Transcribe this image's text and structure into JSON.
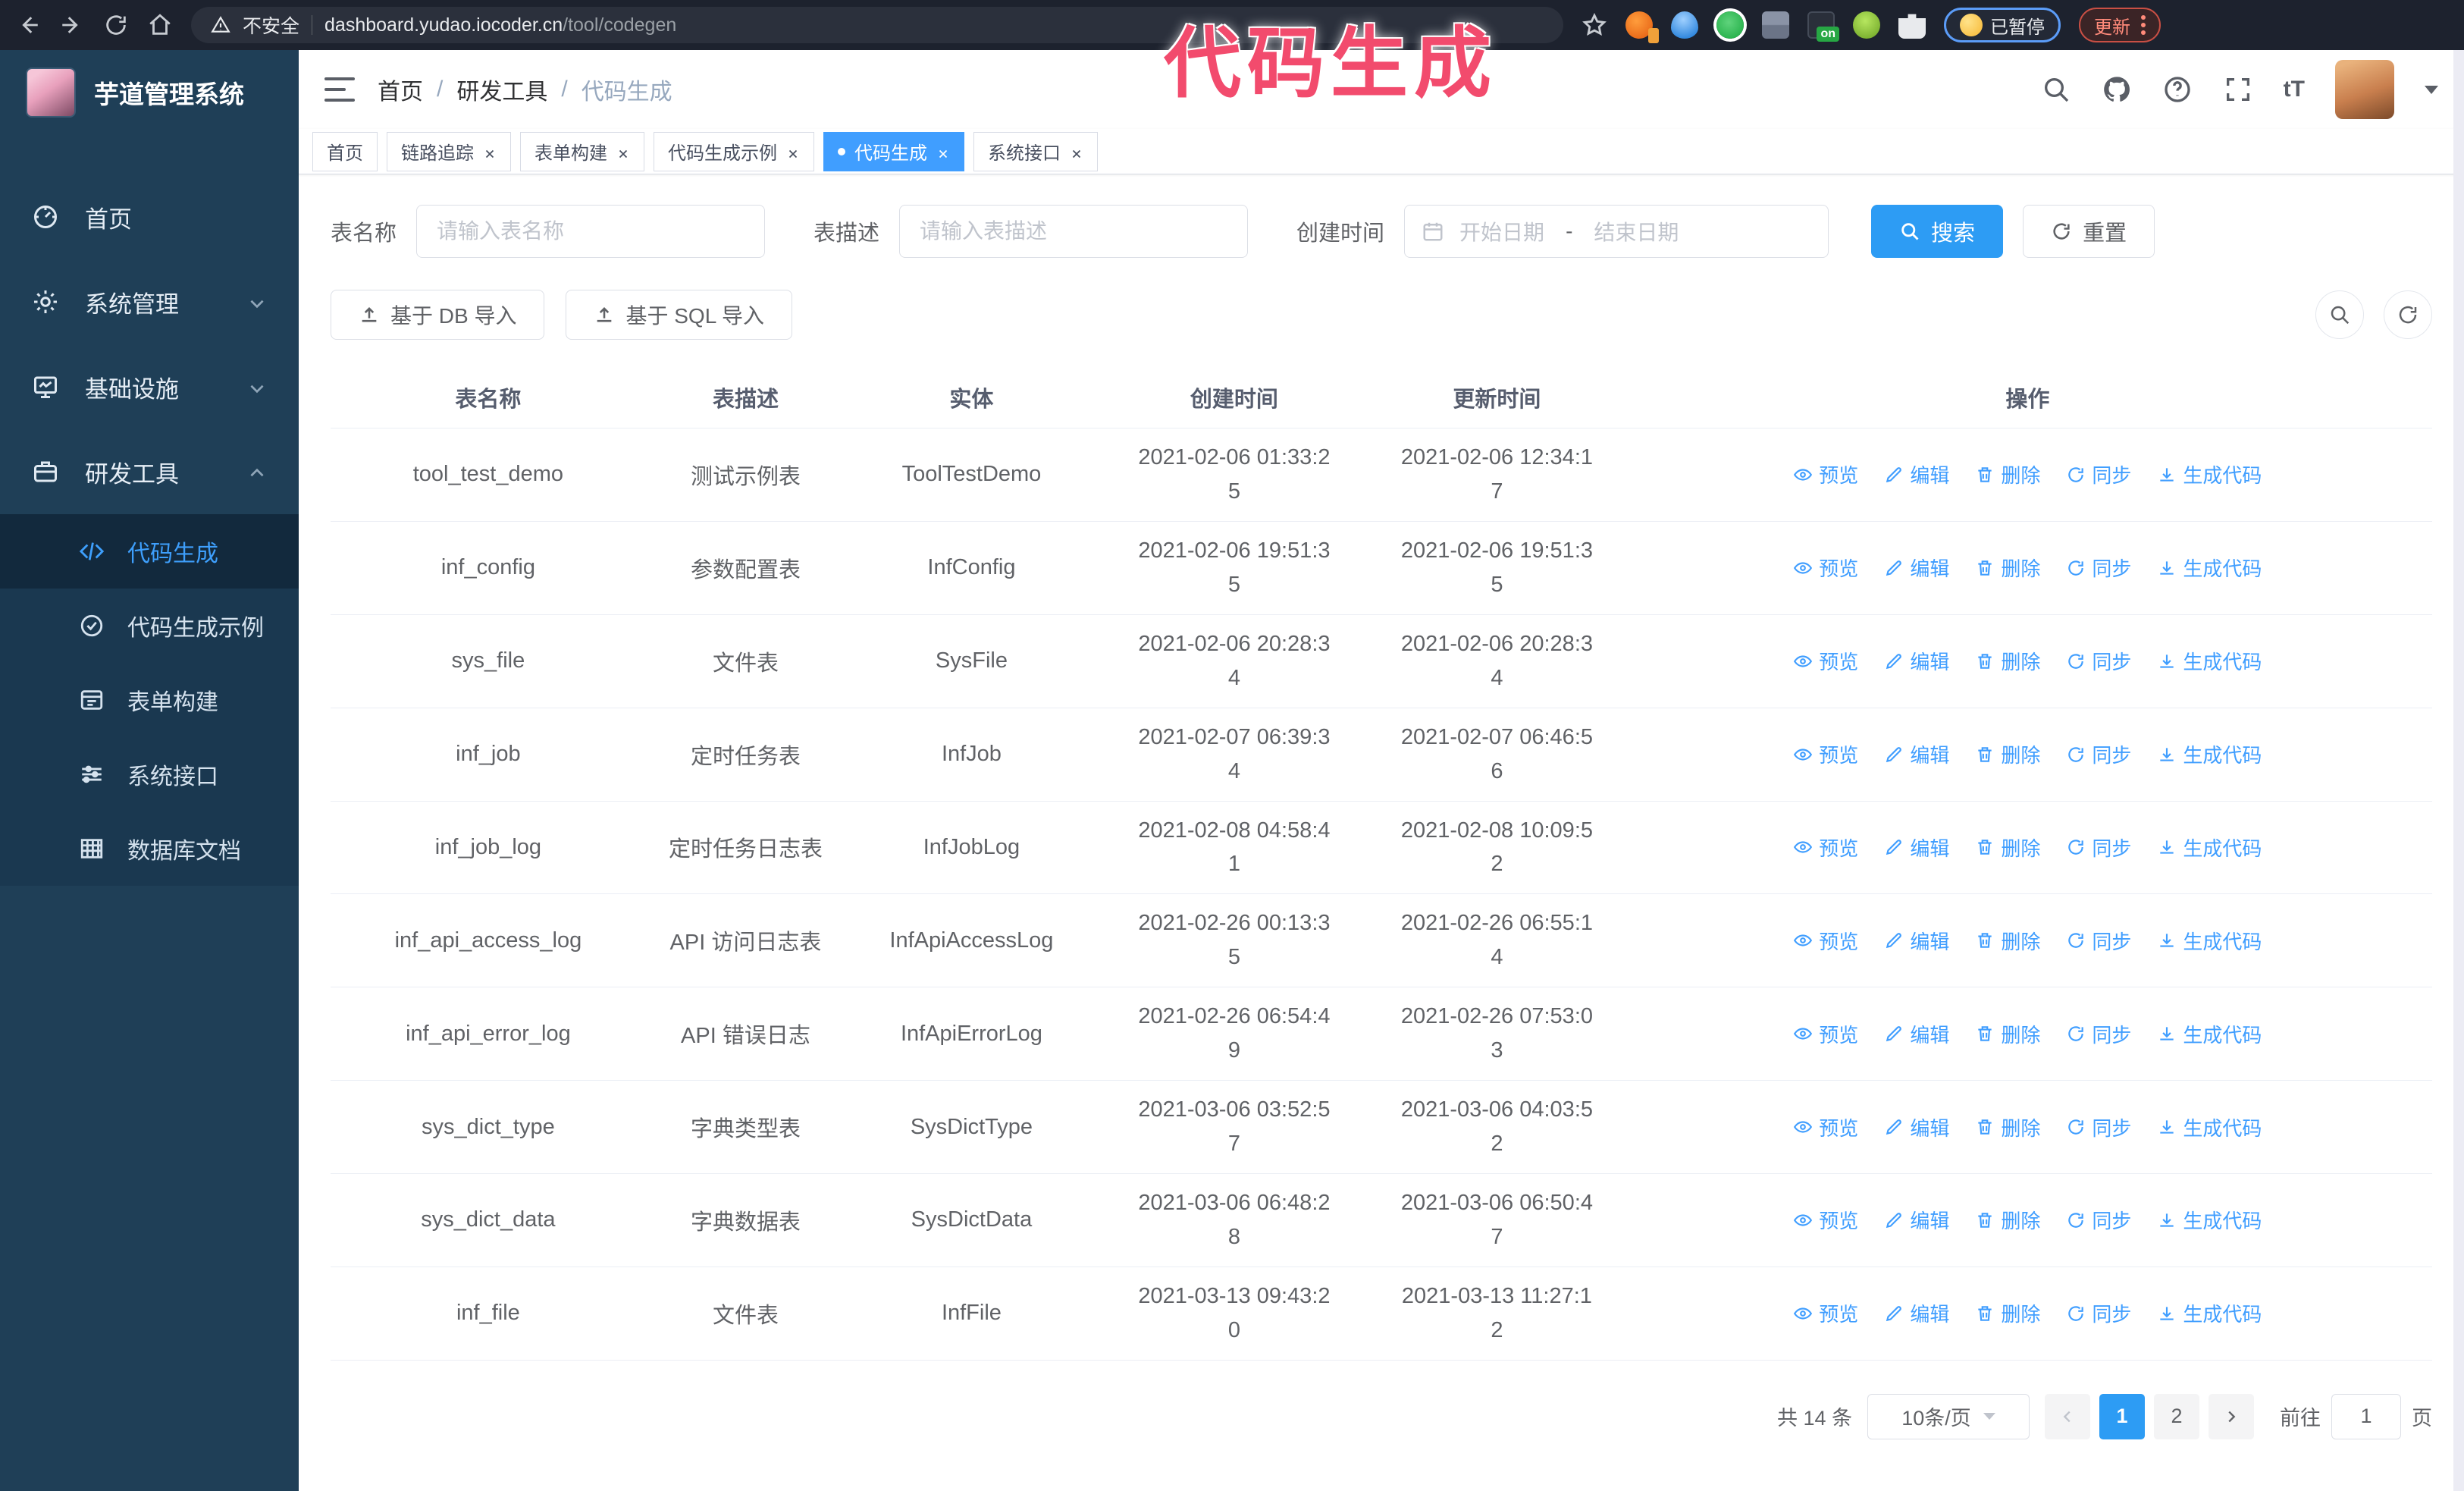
{
  "browser": {
    "security_label": "不安全",
    "url_host": "dashboard.yudao.iocoder.cn",
    "url_path": "/tool/codegen",
    "ext_on_label": "on",
    "paused_label": "已暂停",
    "update_label": "更新"
  },
  "annotation": "代码生成",
  "sidebar": {
    "title": "芋道管理系统",
    "items": [
      {
        "label": "首页"
      },
      {
        "label": "系统管理"
      },
      {
        "label": "基础设施"
      },
      {
        "label": "研发工具"
      }
    ],
    "submenu": [
      {
        "label": "代码生成"
      },
      {
        "label": "代码生成示例"
      },
      {
        "label": "表单构建"
      },
      {
        "label": "系统接口"
      },
      {
        "label": "数据库文档"
      }
    ]
  },
  "breadcrumb": {
    "separator": "/",
    "items": [
      "首页",
      "研发工具",
      "代码生成"
    ]
  },
  "tabs": [
    {
      "label": "首页",
      "closable": false,
      "active": false
    },
    {
      "label": "链路追踪",
      "closable": true,
      "active": false
    },
    {
      "label": "表单构建",
      "closable": true,
      "active": false
    },
    {
      "label": "代码生成示例",
      "closable": true,
      "active": false
    },
    {
      "label": "代码生成",
      "closable": true,
      "active": true
    },
    {
      "label": "系统接口",
      "closable": true,
      "active": false
    }
  ],
  "search_form": {
    "table_name_label": "表名称",
    "table_name_placeholder": "请输入表名称",
    "table_desc_label": "表描述",
    "table_desc_placeholder": "请输入表描述",
    "create_time_label": "创建时间",
    "start_date_placeholder": "开始日期",
    "range_separator": "-",
    "end_date_placeholder": "结束日期",
    "search_label": "搜索",
    "reset_label": "重置"
  },
  "toolbar": {
    "import_db_label": "基于 DB 导入",
    "import_sql_label": "基于 SQL 导入"
  },
  "table": {
    "columns": [
      "表名称",
      "表描述",
      "实体",
      "创建时间",
      "更新时间",
      "操作"
    ],
    "actions": [
      "预览",
      "编辑",
      "删除",
      "同步",
      "生成代码"
    ],
    "rows": [
      {
        "name": "tool_test_demo",
        "desc": "测试示例表",
        "entity": "ToolTestDemo",
        "created": "2021-02-06 01:33:25",
        "updated": "2021-02-06 12:34:17"
      },
      {
        "name": "inf_config",
        "desc": "参数配置表",
        "entity": "InfConfig",
        "created": "2021-02-06 19:51:35",
        "updated": "2021-02-06 19:51:35"
      },
      {
        "name": "sys_file",
        "desc": "文件表",
        "entity": "SysFile",
        "created": "2021-02-06 20:28:34",
        "updated": "2021-02-06 20:28:34"
      },
      {
        "name": "inf_job",
        "desc": "定时任务表",
        "entity": "InfJob",
        "created": "2021-02-07 06:39:34",
        "updated": "2021-02-07 06:46:56"
      },
      {
        "name": "inf_job_log",
        "desc": "定时任务日志表",
        "entity": "InfJobLog",
        "created": "2021-02-08 04:58:41",
        "updated": "2021-02-08 10:09:52"
      },
      {
        "name": "inf_api_access_log",
        "desc": "API 访问日志表",
        "entity": "InfApiAccessLog",
        "created": "2021-02-26 00:13:35",
        "updated": "2021-02-26 06:55:14"
      },
      {
        "name": "inf_api_error_log",
        "desc": "API 错误日志",
        "entity": "InfApiErrorLog",
        "created": "2021-02-26 06:54:49",
        "updated": "2021-02-26 07:53:03"
      },
      {
        "name": "sys_dict_type",
        "desc": "字典类型表",
        "entity": "SysDictType",
        "created": "2021-03-06 03:52:57",
        "updated": "2021-03-06 04:03:52"
      },
      {
        "name": "sys_dict_data",
        "desc": "字典数据表",
        "entity": "SysDictData",
        "created": "2021-03-06 06:48:28",
        "updated": "2021-03-06 06:50:47"
      },
      {
        "name": "inf_file",
        "desc": "文件表",
        "entity": "InfFile",
        "created": "2021-03-13 09:43:20",
        "updated": "2021-03-13 11:27:12"
      }
    ]
  },
  "pagination": {
    "total_label": "共 14 条",
    "page_size_label": "10条/页",
    "pages": [
      "1",
      "2"
    ],
    "active_page": "1",
    "goto_label": "前往",
    "goto_value": "1",
    "page_label": "页"
  },
  "colors": {
    "primary": "#409eff",
    "sidebar_bg": "#1f3f57",
    "submenu_bg": "#1a3850",
    "browser_bg": "#1d222e",
    "annotation": "#f24b6d"
  }
}
